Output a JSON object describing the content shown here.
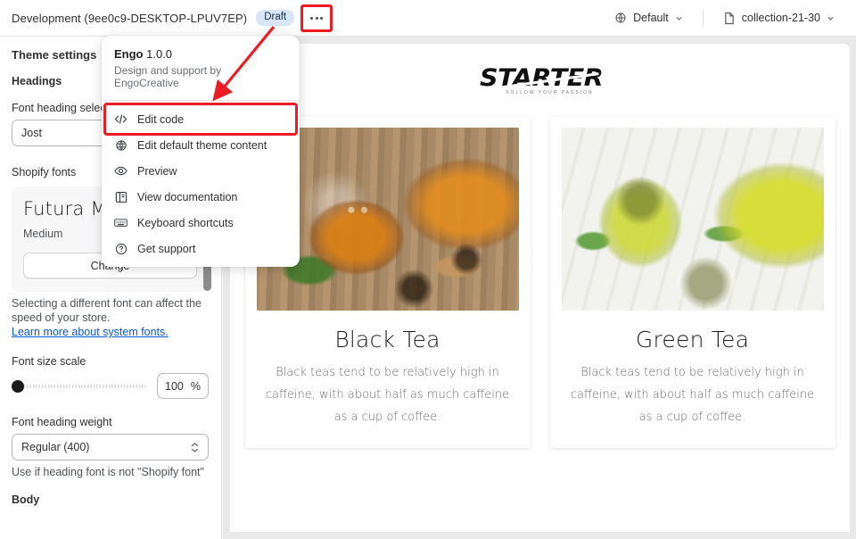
{
  "topbar": {
    "theme_name": "Development (9ee0c9-DESKTOP-LPUV7EP)",
    "status_badge": "Draft",
    "more_button_label": "",
    "locale_selector": "Default",
    "page_selector": "collection-21-30"
  },
  "menu": {
    "app_name": "Engo",
    "app_version": "1.0.0",
    "subtitle": "Design and support by EngoCreative",
    "items": [
      {
        "label": "Edit code",
        "icon": "code-icon",
        "highlighted": true
      },
      {
        "label": "Edit default theme content",
        "icon": "globe-icon",
        "highlighted": false
      },
      {
        "label": "Preview",
        "icon": "eye-icon",
        "highlighted": false
      },
      {
        "label": "View documentation",
        "icon": "book-icon",
        "highlighted": false
      },
      {
        "label": "Keyboard shortcuts",
        "icon": "keyboard-icon",
        "highlighted": false
      },
      {
        "label": "Get support",
        "icon": "question-circle-icon",
        "highlighted": false
      }
    ]
  },
  "sidebar": {
    "title": "Theme settings",
    "section_headings": "Headings",
    "font_heading_select_label": "Font heading select",
    "font_heading_select_value": "Jost",
    "shopify_fonts_label": "Shopify fonts",
    "font_preview_name": "Futura Medium",
    "font_preview_weight": "Medium",
    "change_button": "Change",
    "help_text": "Selecting a different font can affect the speed of your store.",
    "help_link": "Learn more about system fonts.",
    "font_size_scale_label": "Font size scale",
    "font_size_scale_value": "100",
    "font_size_scale_unit": "%",
    "font_heading_weight_label": "Font heading weight",
    "font_heading_weight_value": "Regular (400)",
    "font_heading_weight_help": "Use if heading font is not \"Shopify font\"",
    "section_body": "Body"
  },
  "preview": {
    "logo_word": "STARTER",
    "logo_tagline": "FOLLOW YOUR PASSION",
    "cards": [
      {
        "title": "Black Tea",
        "description": "Black teas tend to be relatively high in caffeine, with about half as much caffeine as a cup of coffee.",
        "image_name": "black-tea-photo"
      },
      {
        "title": "Green Tea",
        "description": "Black teas tend to be relatively high in caffeine, with about half as much caffeine as a cup of coffee.",
        "image_name": "green-tea-photo"
      }
    ]
  },
  "annotation": {
    "highlight_color": "#ed1c24"
  }
}
